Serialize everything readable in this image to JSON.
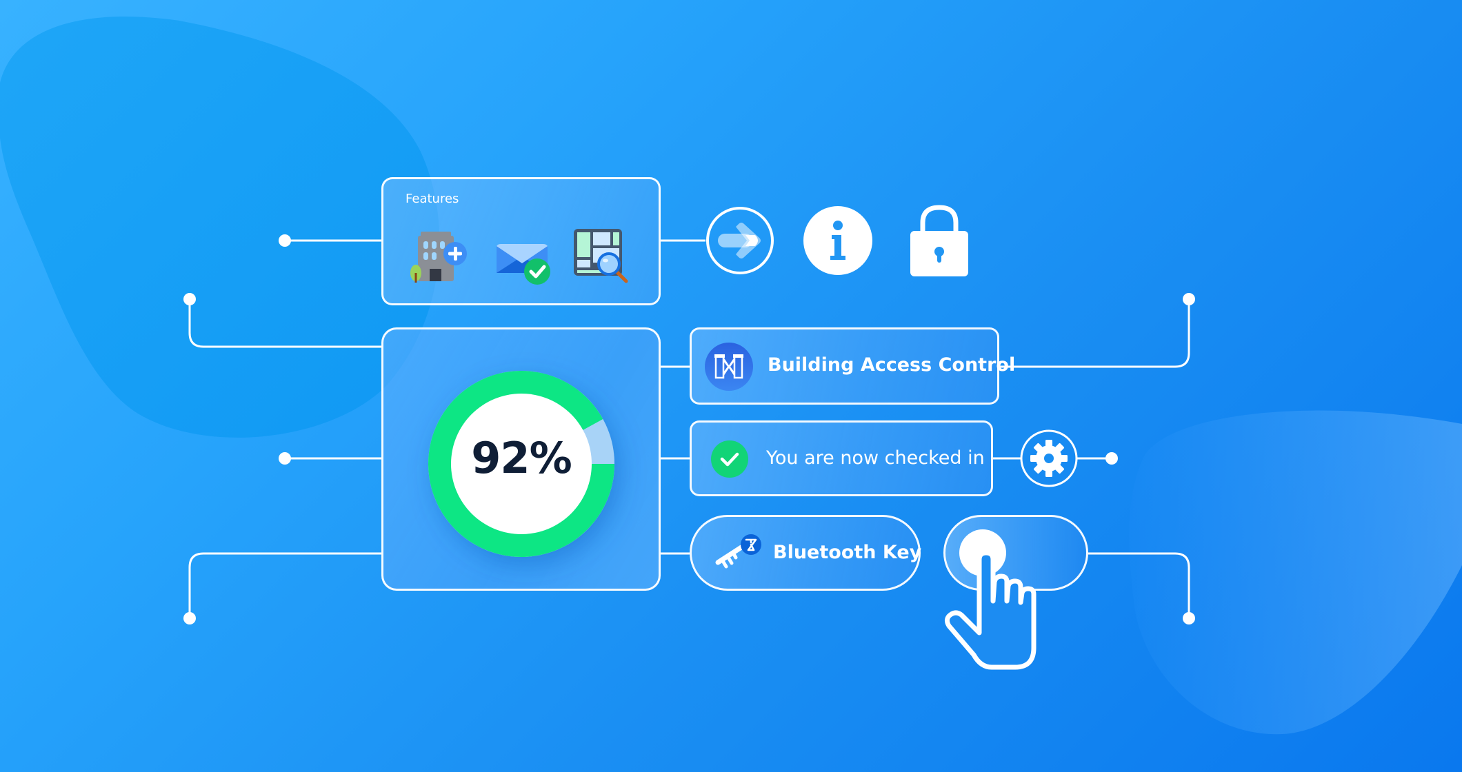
{
  "colors": {
    "background_light": "#38b2ff",
    "background_dark": "#0a78ee",
    "line": "#ffffff",
    "donut_progress": "#0de684",
    "donut_remainder": "#a8d3f7",
    "donut_text": "#0f1e36",
    "check_green": "#12d477",
    "access_icon_bg": "#2f6ee8",
    "bluetooth_badge": "#0a63d8"
  },
  "features_card": {
    "label": "Features",
    "icons": [
      "building-add-icon",
      "mail-check-icon",
      "floorplan-search-icon"
    ]
  },
  "top_icons": [
    "arrow-right-circle-icon",
    "info-icon",
    "lock-icon"
  ],
  "progress": {
    "value_label": "92%",
    "fraction": 0.92
  },
  "cards": {
    "building_access": {
      "label": "Building Access Control",
      "icon": "access-gate-icon"
    },
    "checked_in": {
      "label": "You are now checked in",
      "icon": "check-circle-icon"
    },
    "bluetooth": {
      "label": "Bluetooth Key",
      "icon": "bluetooth-key-icon"
    },
    "toggle": {
      "state": "on",
      "icon": "hand-pointer-icon"
    },
    "settings": {
      "icon": "gear-icon"
    }
  }
}
